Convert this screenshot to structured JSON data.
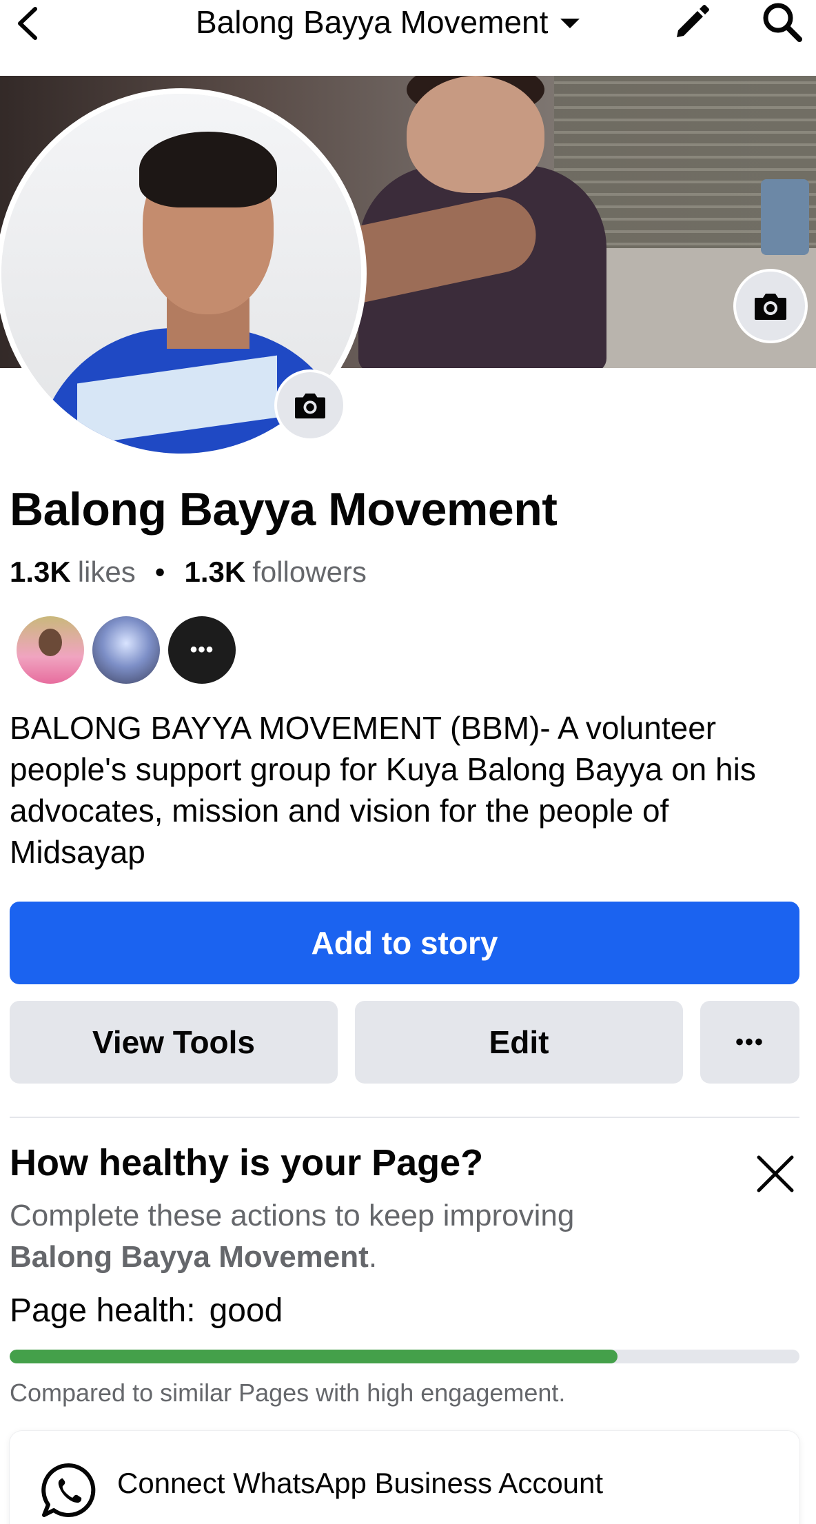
{
  "header": {
    "title": "Balong Bayya Movement",
    "back_icon": "chevron-left-icon",
    "caret_icon": "caret-down-icon",
    "edit_icon": "pencil-icon",
    "search_icon": "search-icon"
  },
  "cover": {
    "camera_icon": "camera-icon"
  },
  "profile": {
    "camera_icon": "camera-icon"
  },
  "page": {
    "name": "Balong Bayya Movement",
    "likes_count": "1.3K",
    "likes_label": "likes",
    "separator": "•",
    "followers_count": "1.3K",
    "followers_label": "followers",
    "friends_more": "•••",
    "bio": "BALONG BAYYA MOVEMENT (BBM)- A volunteer people's support group for Kuya Balong Bayya on his advocates, mission and vision for the people of Midsayap"
  },
  "actions": {
    "add_to_story": "Add to story",
    "view_tools": "View Tools",
    "edit": "Edit",
    "more": "•••"
  },
  "health": {
    "title": "How healthy is your Page?",
    "desc_prefix": "Complete these actions to keep improving",
    "desc_page": "Balong Bayya Movement",
    "desc_suffix": ".",
    "status_label": "Page health:",
    "status_value": "good",
    "progress": 0.77,
    "compare_text": "Compared to similar Pages with high engagement.",
    "close_icon": "close-icon"
  },
  "whatsapp": {
    "label": "Connect WhatsApp Business Account",
    "icon": "whatsapp-icon"
  },
  "colors": {
    "primary": "#1b63f0",
    "progress": "#44a04a",
    "secondary_bg": "#e4e6eb",
    "muted_text": "#65676b"
  }
}
